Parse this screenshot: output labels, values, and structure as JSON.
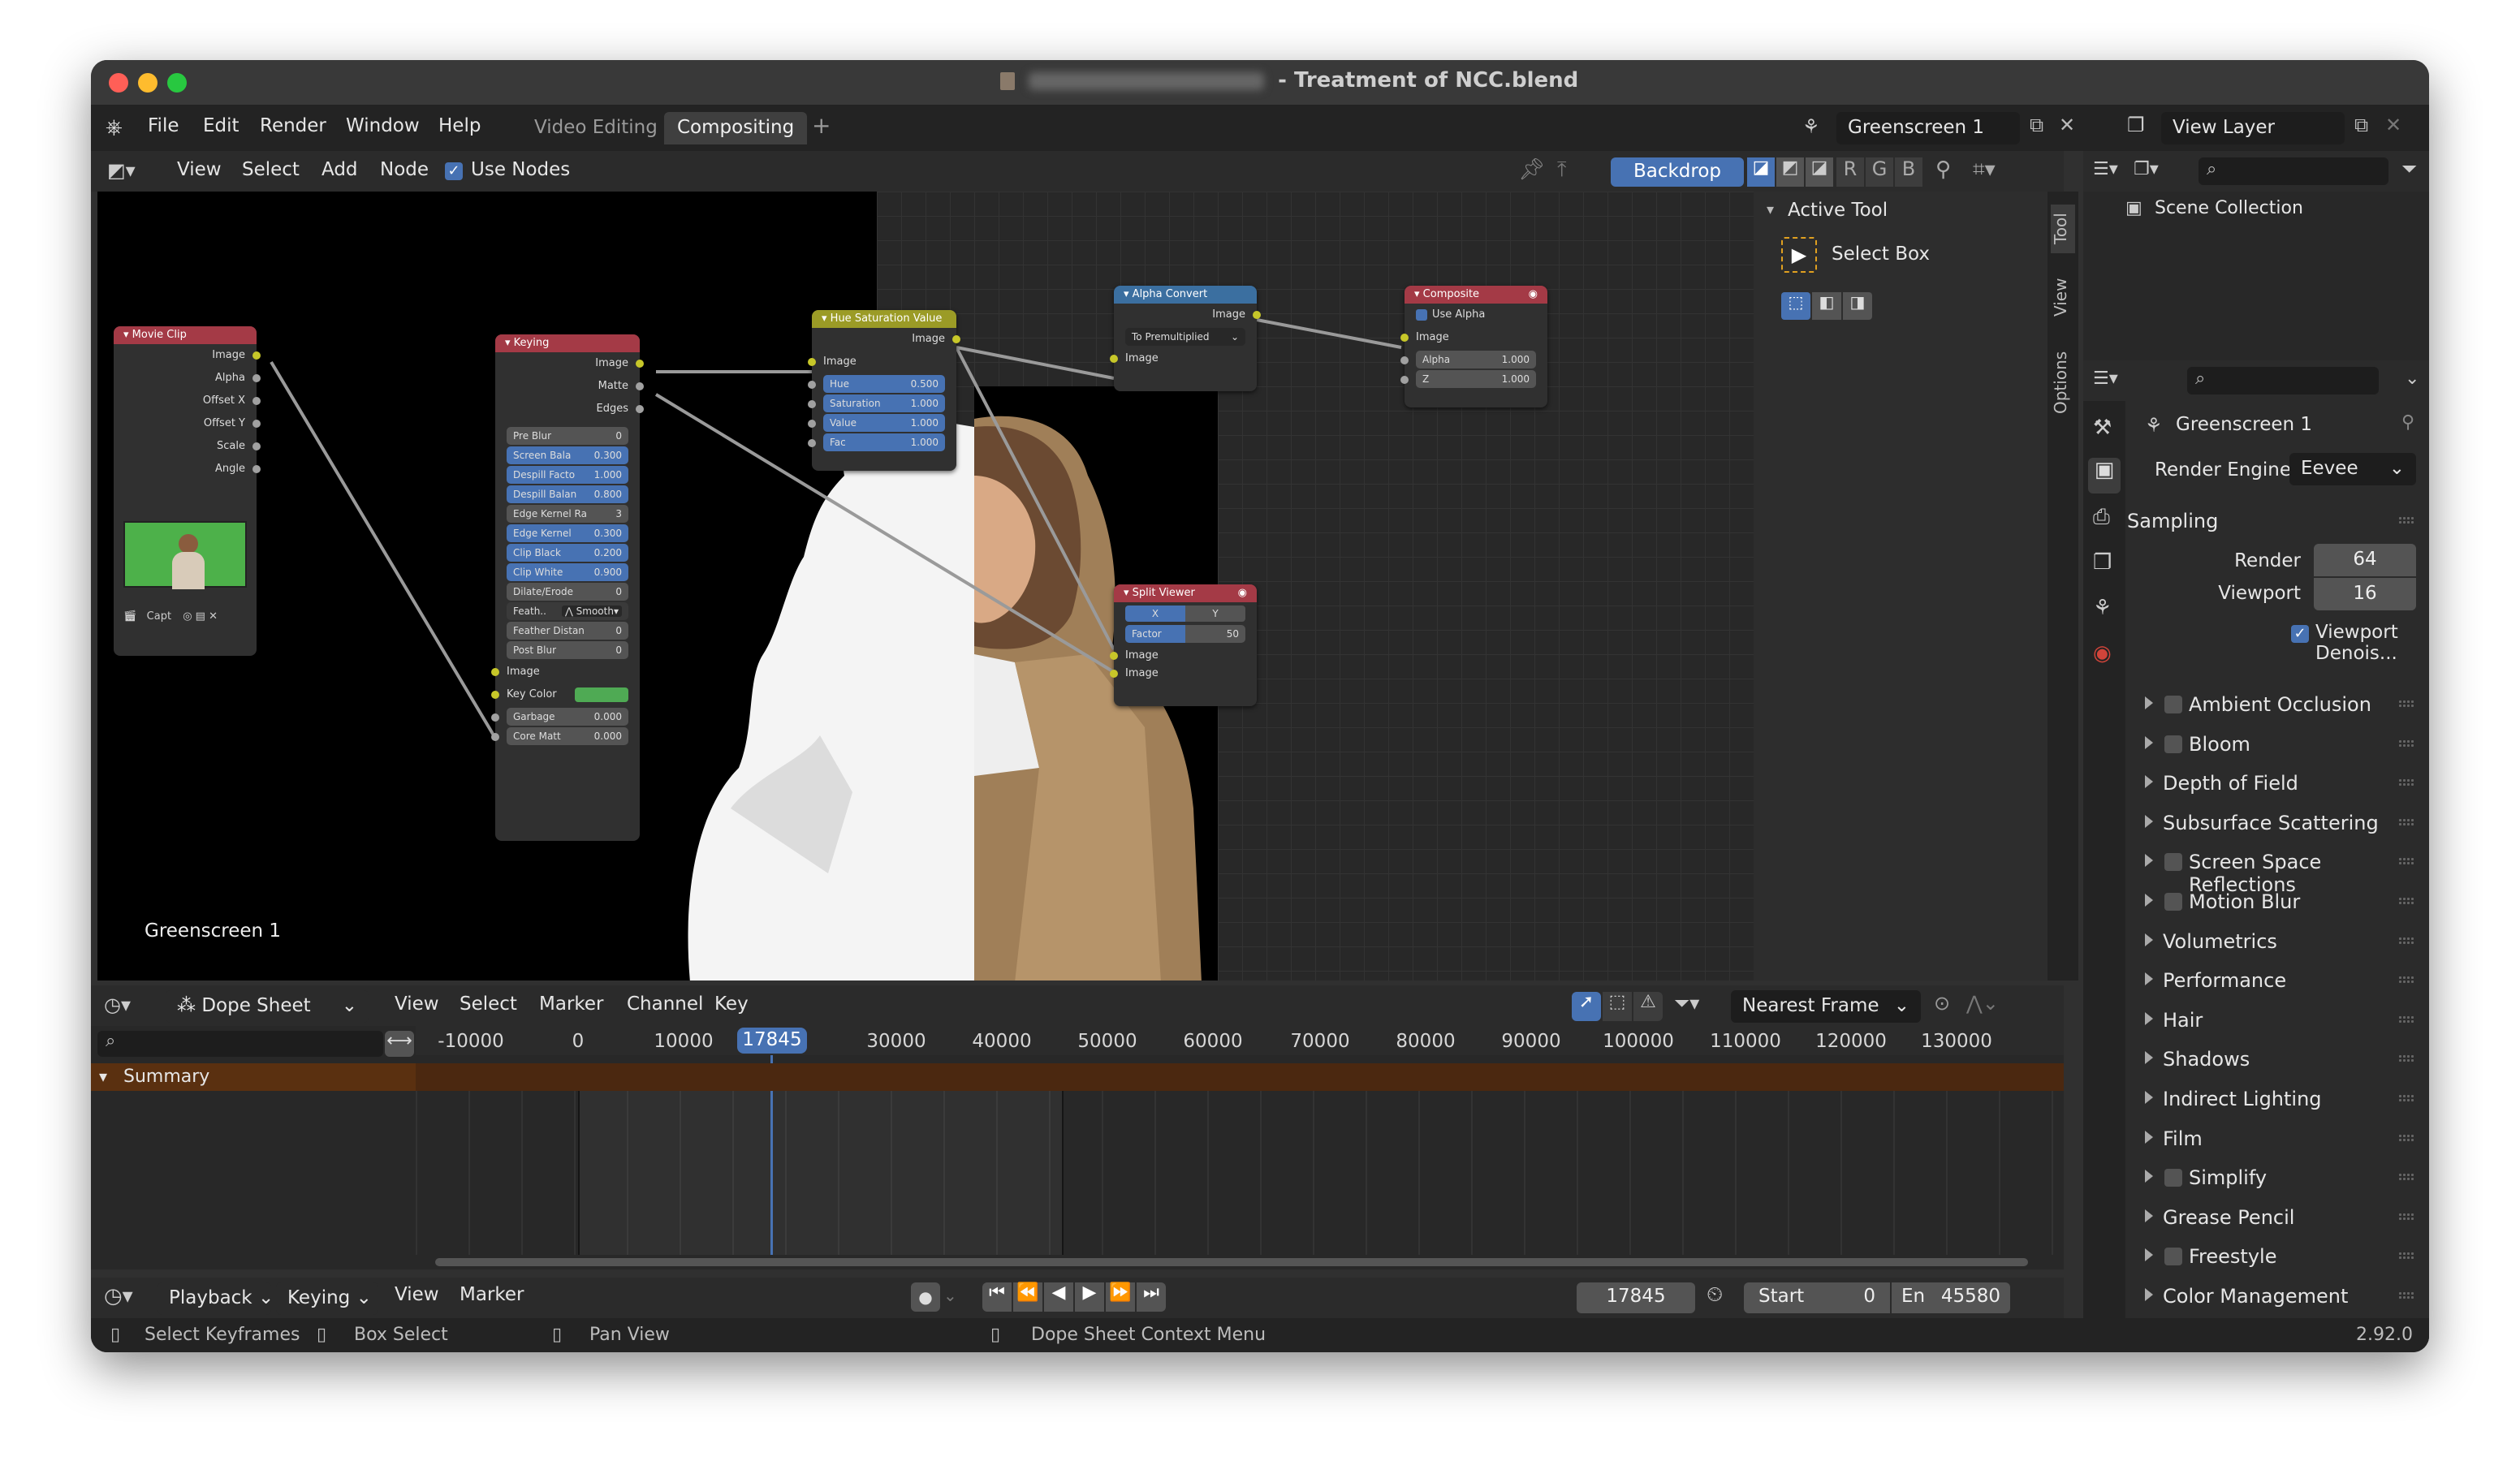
{
  "window": {
    "title_suffix": "- Treatment of NCC.blend",
    "traffic_colors": [
      "#ff5f57",
      "#febc2e",
      "#28c840"
    ]
  },
  "menubar": {
    "items": [
      "File",
      "Edit",
      "Render",
      "Window",
      "Help"
    ],
    "workspaces": [
      "Video Editing",
      "Compositing"
    ],
    "add_tab": "+",
    "scene": "Greenscreen 1",
    "view_layer": "View Layer"
  },
  "node_header": {
    "menus": [
      "View",
      "Select",
      "Add",
      "Node"
    ],
    "use_nodes": "Use Nodes",
    "backdrop": "Backdrop",
    "channels": [
      "R",
      "G",
      "B"
    ]
  },
  "nodes": {
    "movie_clip": {
      "title": "Movie Clip",
      "outputs": [
        "Image",
        "Alpha",
        "Offset X",
        "Offset Y",
        "Scale",
        "Angle"
      ],
      "clip_name": "Capt"
    },
    "keying": {
      "title": "Keying",
      "outputs": [
        "Image",
        "Matte",
        "Edges"
      ],
      "params": [
        {
          "label": "Pre Blur",
          "value": "0",
          "blue": false
        },
        {
          "label": "Screen Bala",
          "value": "0.300",
          "blue": true
        },
        {
          "label": "Despill Facto",
          "value": "1.000",
          "blue": true
        },
        {
          "label": "Despill Balan",
          "value": "0.800",
          "blue": true
        },
        {
          "label": "Edge Kernel Ra",
          "value": "3",
          "blue": false
        },
        {
          "label": "Edge Kernel",
          "value": "0.300",
          "blue": true
        },
        {
          "label": "Clip Black",
          "value": "0.200",
          "blue": true
        },
        {
          "label": "Clip White",
          "value": "0.900",
          "blue": true
        },
        {
          "label": "Dilate/Erode",
          "value": "0",
          "blue": false
        }
      ],
      "feather_label": "Feath..",
      "feather_mode": "Smooth",
      "params2": [
        {
          "label": "Feather Distan",
          "value": "0"
        },
        {
          "label": "Post Blur",
          "value": "0"
        }
      ],
      "inputs": [
        "Image",
        "Key Color"
      ],
      "inputs2": [
        {
          "label": "Garbage",
          "value": "0.000"
        },
        {
          "label": "Core Matt",
          "value": "0.000"
        }
      ],
      "key_color": "#4faa54"
    },
    "hue_sat": {
      "title": "Hue Saturation Value",
      "output": "Image",
      "input": "Image",
      "params": [
        {
          "label": "Hue",
          "value": "0.500"
        },
        {
          "label": "Saturation",
          "value": "1.000"
        },
        {
          "label": "Value",
          "value": "1.000"
        },
        {
          "label": "Fac",
          "value": "1.000"
        }
      ]
    },
    "alpha_convert": {
      "title": "Alpha Convert",
      "output": "Image",
      "mode": "To Premultiplied",
      "input": "Image"
    },
    "composite": {
      "title": "Composite",
      "use_alpha": "Use Alpha",
      "input": "Image",
      "params": [
        {
          "label": "Alpha",
          "value": "1.000"
        },
        {
          "label": "Z",
          "value": "1.000"
        }
      ]
    },
    "split_viewer": {
      "title": "Split Viewer",
      "axes": [
        "X",
        "Y"
      ],
      "factor_label": "Factor",
      "factor_value": "50",
      "inputs": [
        "Image",
        "Image"
      ]
    }
  },
  "backdrop_label": "Greenscreen 1",
  "sidebar": {
    "section": "Active Tool",
    "tool": "Select Box",
    "tabs": [
      "Tool",
      "View",
      "Options"
    ]
  },
  "outliner": {
    "root": "Scene Collection"
  },
  "properties": {
    "scene_name": "Greenscreen 1",
    "render_engine_label": "Render Engine",
    "render_engine": "Eevee",
    "sampling": "Sampling",
    "render_label": "Render",
    "render_value": "64",
    "viewport_label": "Viewport",
    "viewport_value": "16",
    "viewport_denoise": "Viewport Denois...",
    "panels": [
      {
        "label": "Ambient Occlusion",
        "checkbox": true
      },
      {
        "label": "Bloom",
        "checkbox": true
      },
      {
        "label": "Depth of Field",
        "checkbox": false
      },
      {
        "label": "Subsurface Scattering",
        "checkbox": false
      },
      {
        "label": "Screen Space Reflections",
        "checkbox": true
      },
      {
        "label": "Motion Blur",
        "checkbox": true
      },
      {
        "label": "Volumetrics",
        "checkbox": false
      },
      {
        "label": "Performance",
        "checkbox": false
      },
      {
        "label": "Hair",
        "checkbox": false
      },
      {
        "label": "Shadows",
        "checkbox": false
      },
      {
        "label": "Indirect Lighting",
        "checkbox": false
      },
      {
        "label": "Film",
        "checkbox": false
      },
      {
        "label": "Simplify",
        "checkbox": true
      },
      {
        "label": "Grease Pencil",
        "checkbox": false
      },
      {
        "label": "Freestyle",
        "checkbox": true
      },
      {
        "label": "Color Management",
        "checkbox": false
      }
    ]
  },
  "dopesheet": {
    "editor": "Dope Sheet",
    "menus": [
      "View",
      "Select",
      "Marker",
      "Channel",
      "Key"
    ],
    "snap": "Nearest Frame",
    "summary": "Summary",
    "ruler_ticks": [
      "-10000",
      "0",
      "10000",
      "0",
      "30000",
      "40000",
      "50000",
      "60000",
      "70000",
      "80000",
      "90000",
      "100000",
      "110000",
      "120000",
      "130000"
    ],
    "current_frame": "17845"
  },
  "timeline": {
    "menus": [
      "Playback",
      "Keying",
      "View",
      "Marker"
    ],
    "frame": "17845",
    "start_label": "Start",
    "start_value": "0",
    "end_label": "En",
    "end_value": "45580"
  },
  "status": {
    "items": [
      "Select Keyframes",
      "Box Select",
      "Pan View",
      "Dope Sheet Context Menu"
    ],
    "version": "2.92.0"
  }
}
